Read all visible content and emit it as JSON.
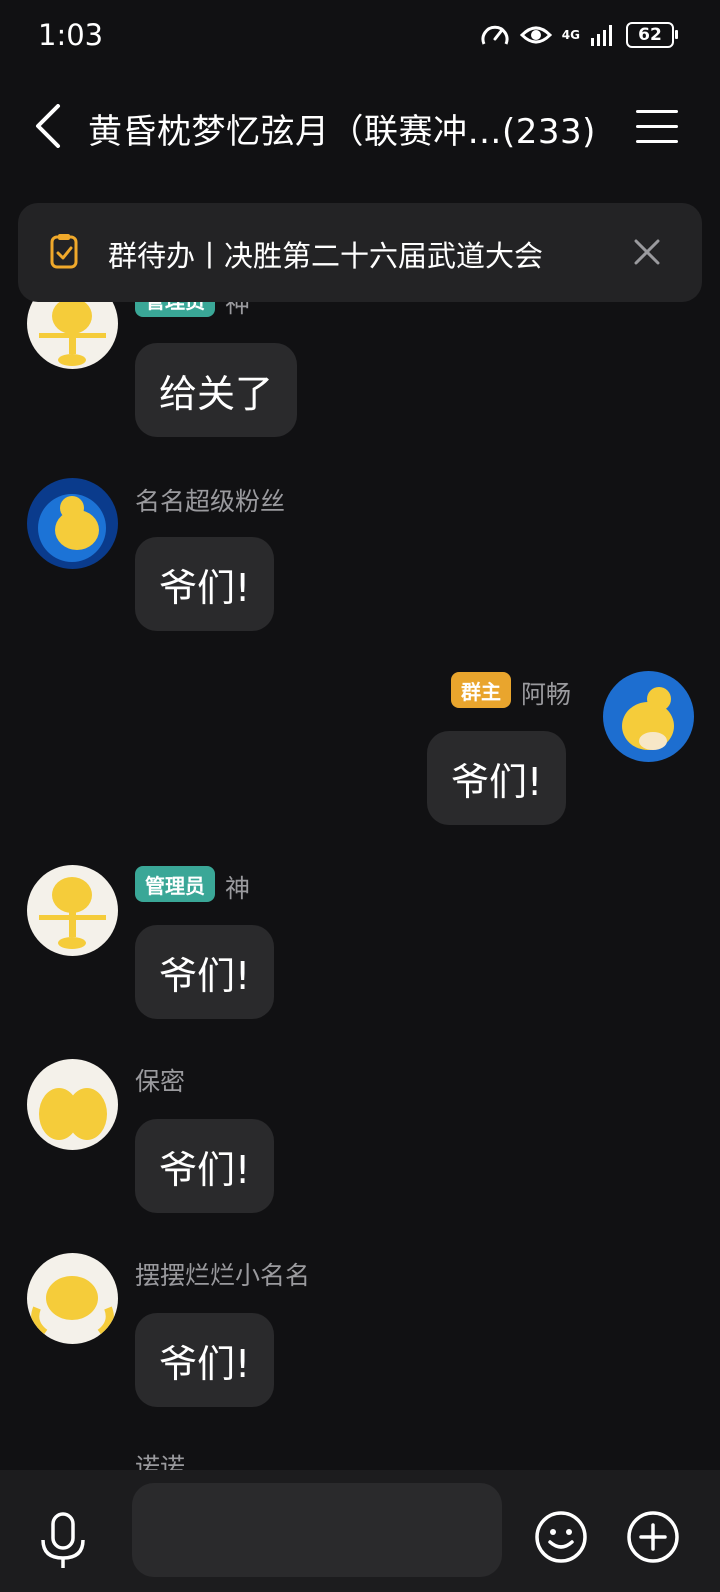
{
  "status": {
    "time": "1:03",
    "network": "4G",
    "battery": "62"
  },
  "header": {
    "title": "黄昏枕梦忆弦月（联赛冲…(233)"
  },
  "todo": {
    "text": "群待办丨决胜第二十六届武道大会"
  },
  "messages": [
    {
      "nick": "神",
      "badge": "管理员",
      "text": "给关了"
    },
    {
      "nick": "名名超级粉丝",
      "text": "爷们!"
    },
    {
      "nick": "阿畅",
      "badge": "群主",
      "text": "爷们!",
      "self": true
    },
    {
      "nick": "神",
      "badge": "管理员",
      "text": "爷们!"
    },
    {
      "nick": "保密",
      "text": "爷们!"
    },
    {
      "nick": "摆摆烂烂小名名",
      "text": "爷们!"
    },
    {
      "nick": "诺诺"
    }
  ],
  "colors": {
    "background": "#111113",
    "bubble": "#2a2a2c",
    "admin_badge": "#3aa797",
    "owner_badge": "#e9a52d",
    "nick": "#9a9a9e"
  },
  "icons": [
    "back-icon",
    "menu-icon",
    "todo-check-icon",
    "close-icon",
    "mic-icon",
    "emoji-icon",
    "plus-icon"
  ]
}
